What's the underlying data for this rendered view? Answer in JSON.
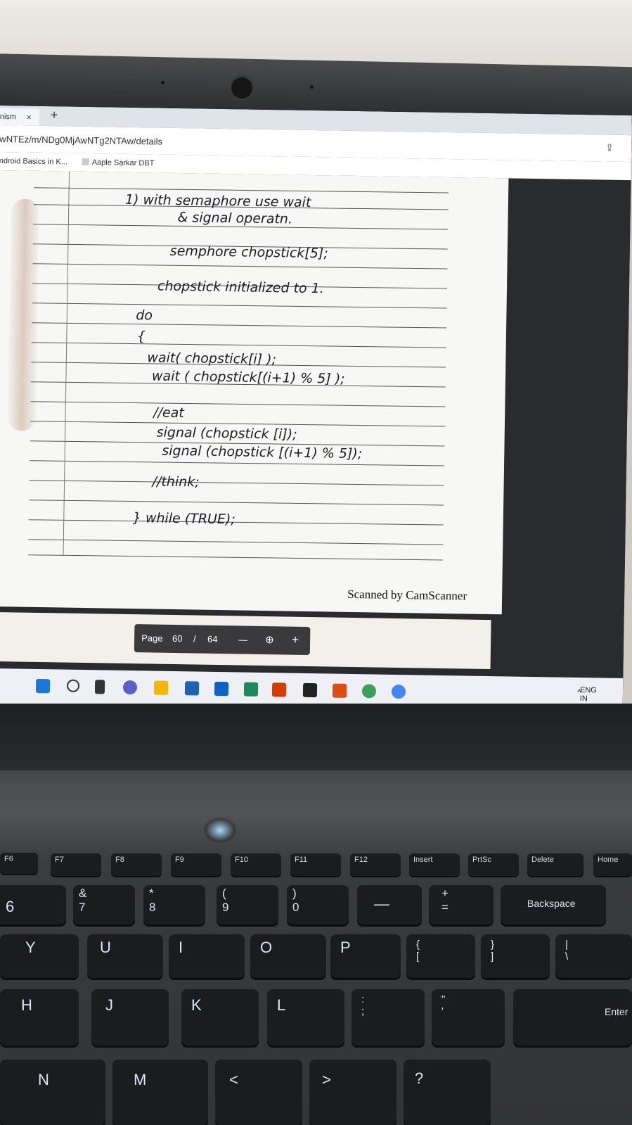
{
  "browser": {
    "tab_title": "nism",
    "tab_close": "×",
    "new_tab": "+",
    "url": "wNTEz/m/NDg0MjAwNTg2NTAw/details",
    "bookmarks": [
      {
        "label": "ndroid Basics in K..."
      },
      {
        "label": "Aaple Sarkar DBT"
      }
    ]
  },
  "document": {
    "handwritten_lines": [
      "1) with semaphore use wait",
      "& signal operatn.",
      "semphore chopstick[5];",
      "chopstick initialized to 1.",
      "do",
      "{",
      "wait( chopstick[i] );",
      "wait ( chopstick[(i+1) % 5] );",
      "//eat",
      "signal (chopstick [i]);",
      "signal (chopstick [(i+1) % 5]);",
      "//think;",
      "} while (TRUE);"
    ],
    "scanner_watermark": "Scanned by CamScanner"
  },
  "pdf_toolbar": {
    "page_label": "Page",
    "current_page": "60",
    "separator": "/",
    "total_pages": "64",
    "zoom_out": "—",
    "zoom_in": "+"
  },
  "taskbar": {
    "tray_text_1": "ENG",
    "tray_text_2": "IN"
  },
  "keyboard": {
    "function_keys": [
      "F6",
      "F7",
      "F8",
      "F9",
      "F10",
      "F11",
      "F12",
      "Insert",
      "PrtSc",
      "Delete",
      "Home"
    ],
    "number_row": [
      "6",
      "&\n7",
      "*\n8",
      "(\n9",
      ")\n0",
      "—",
      "+\n=",
      "Backspace"
    ],
    "top_row": [
      "Y",
      "U",
      "I",
      "O",
      "P",
      "{\n[",
      "}\n]",
      "|\n\\"
    ],
    "home_row": [
      "H",
      "J",
      "K",
      "L",
      ":\n;",
      "\"\n'",
      "Enter"
    ],
    "bottom_row": [
      "N",
      "M",
      "<",
      ">",
      "?"
    ]
  },
  "colors": {
    "accent": "#2f6fd6",
    "paper": "#f7f7f5",
    "ink": "#1d1d2a"
  }
}
